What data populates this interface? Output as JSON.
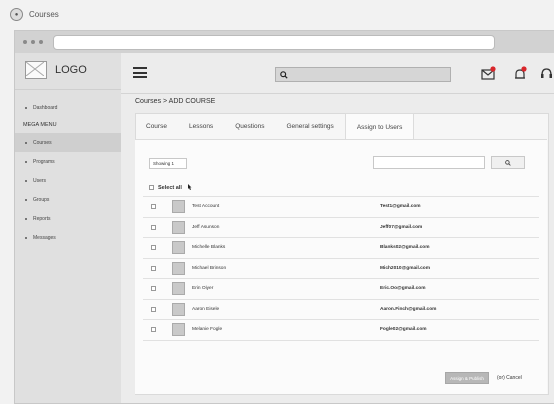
{
  "browser_tab": {
    "title": "Courses"
  },
  "sidebar": {
    "logo": "LOGO",
    "items_top": [
      {
        "label": "Dashboard"
      }
    ],
    "section_label": "MEGA MENU",
    "items": [
      {
        "label": "Courses",
        "active": true
      },
      {
        "label": "Programs"
      },
      {
        "label": "Users"
      },
      {
        "label": "Groups"
      },
      {
        "label": "Reports"
      },
      {
        "label": "Messages"
      }
    ]
  },
  "breadcrumb": "Courses > ADD COURSE",
  "tabs": [
    {
      "label": "Course"
    },
    {
      "label": "Lessons"
    },
    {
      "label": "Questions"
    },
    {
      "label": "General settings"
    },
    {
      "label": "Assign to Users",
      "active": true
    }
  ],
  "filter": {
    "value": "Showing 1"
  },
  "select_all": "Select all",
  "users": [
    {
      "name": "Test Account",
      "email": "Test1@gmail.com"
    },
    {
      "name": "Jeff Asunson",
      "email": "Jeff07@gmail.com"
    },
    {
      "name": "Michelle Blanks",
      "email": "Blanks02@gmail.com"
    },
    {
      "name": "Michael Brinson",
      "email": "Mich2010@gmail.com"
    },
    {
      "name": "Erin Oiyer",
      "email": "Eric.Oo@gmail.com"
    },
    {
      "name": "Aaron Eisele",
      "email": "Aaron.Finch@gmail.com"
    },
    {
      "name": "Melanie Fogle",
      "email": "Fogle02@gmail.com"
    }
  ],
  "actions": {
    "assign": "Assign & Publish",
    "cancel": "(or) Cancel"
  },
  "colors": {
    "badge": "#d9262b",
    "accent": "#b7b7b7"
  }
}
